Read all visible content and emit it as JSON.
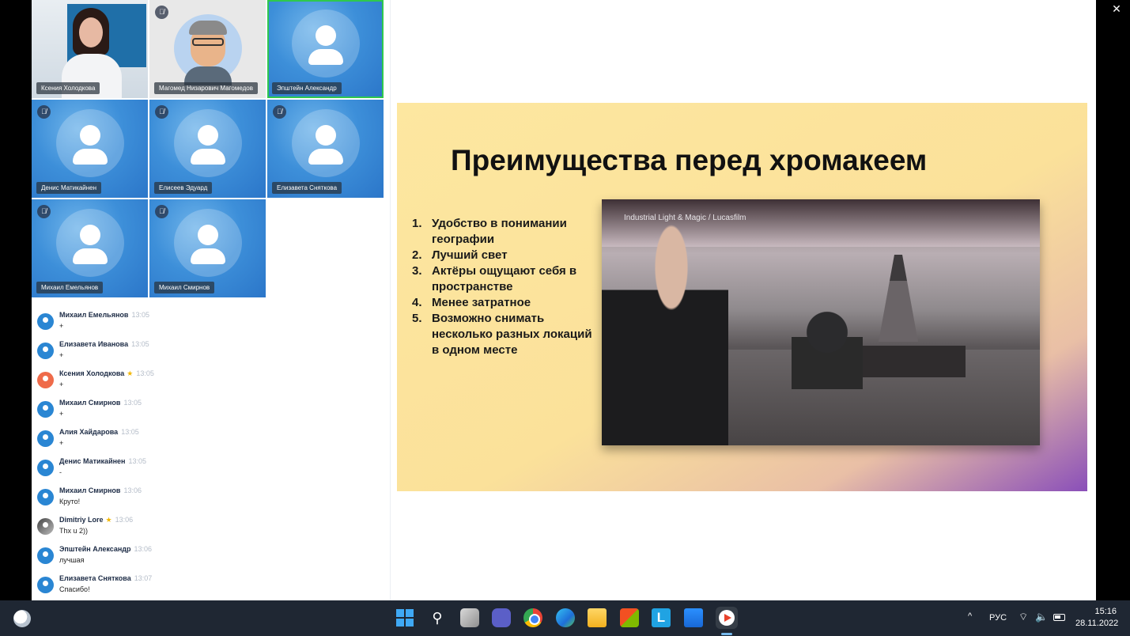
{
  "window": {
    "close_label": "✕"
  },
  "participants": [
    {
      "name": "Ксения Холодкова"
    },
    {
      "name": "Магомед Низарович Магомедов"
    },
    {
      "name": "Эпштейн Александр"
    },
    {
      "name": "Денис Матикайнен"
    },
    {
      "name": "Елисеев Эдуард"
    },
    {
      "name": "Елизавета Сняткова"
    },
    {
      "name": "Михаил Емельянов"
    },
    {
      "name": "Михаил Смирнов"
    }
  ],
  "mute_icon": "🎙̸",
  "chat": [
    {
      "name": "Михаил Емельянов",
      "time": "13:05",
      "text": "+"
    },
    {
      "name": "Елизавета Иванова",
      "time": "13:05",
      "text": "+"
    },
    {
      "name": "Ксения Холодкова",
      "time": "13:05",
      "text": "+",
      "star": "★"
    },
    {
      "name": "Михаил Смирнов",
      "time": "13:05",
      "text": "+"
    },
    {
      "name": "Алия Хайдарова",
      "time": "13:05",
      "text": "+"
    },
    {
      "name": "Денис Матикайнен",
      "time": "13:05",
      "text": "-"
    },
    {
      "name": "Михаил Смирнов",
      "time": "13:06",
      "text": "Круто!"
    },
    {
      "name": "Dimitriy Lore",
      "time": "13:06",
      "text": "Thx u 2))",
      "star": "★"
    },
    {
      "name": "Эпштейн Александр",
      "time": "13:06",
      "text": "лучшая"
    },
    {
      "name": "Елизавета Сняткова",
      "time": "13:07",
      "text": "Спасибо!"
    }
  ],
  "slide": {
    "title": "Преимущества перед хромакеем",
    "items": [
      {
        "num": "1.",
        "text": "Удобство в понимании географии"
      },
      {
        "num": "2.",
        "text": "Лучший свет"
      },
      {
        "num": "3.",
        "text": "Актёры ощущают себя в пространстве"
      },
      {
        "num": "4.",
        "text": "Менее затратное"
      },
      {
        "num": "5.",
        "text": "Возможно снимать несколько разных локаций в одном месте"
      }
    ],
    "photo_caption": "Industrial Light & Magic / Lucasfilm"
  },
  "taskbar": {
    "search_glyph": "⚲",
    "l_app_letter": "L",
    "tray_chevron": "^",
    "language": "РУС",
    "wifi_glyph": "⌔",
    "volume_glyph": "🔈",
    "time": "15:16",
    "date": "28.11.2022"
  }
}
